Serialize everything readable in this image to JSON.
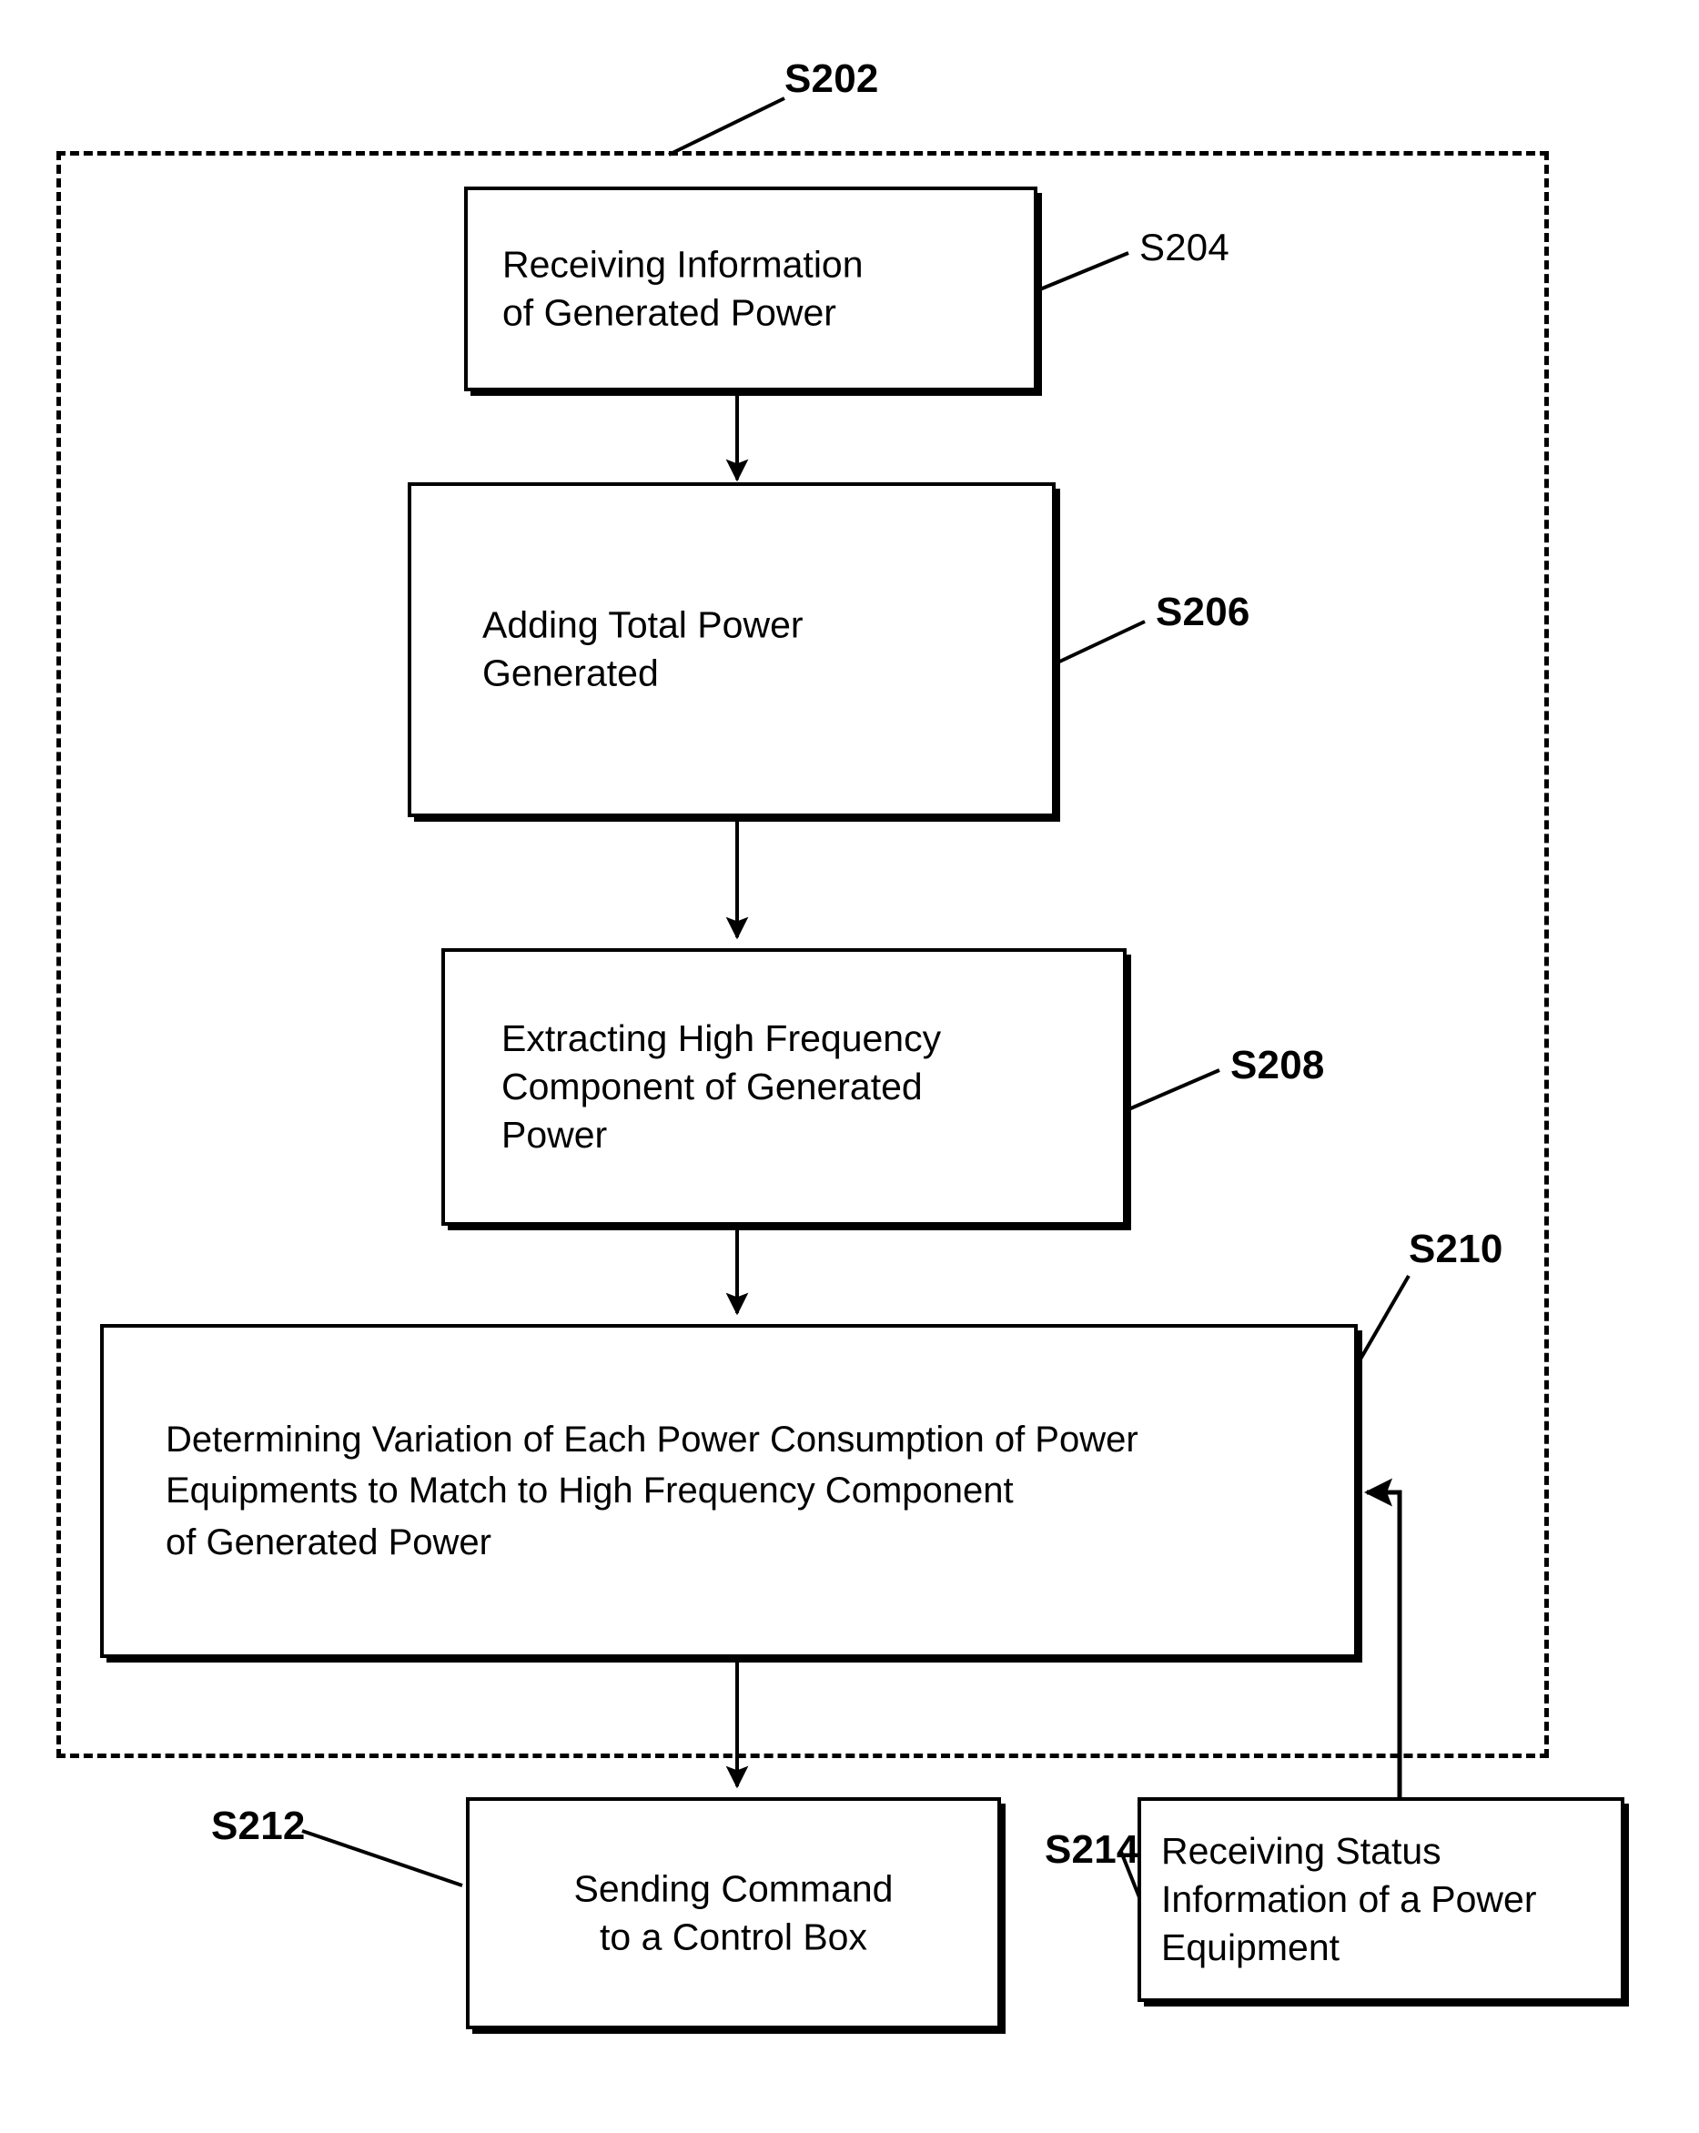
{
  "figure": {
    "type": "patent-process-flowchart",
    "title_label": "S202",
    "ink_color": "#000000",
    "background_color": "#ffffff"
  },
  "boundary": {
    "name": "dashed-process-boundary",
    "ref": "S202",
    "style": "dashed"
  },
  "steps": [
    {
      "ref": "S204",
      "ref_weight": "regular",
      "text": "Receiving Information\nof Generated Power",
      "align": "left"
    },
    {
      "ref": "S206",
      "ref_weight": "bold",
      "text": "Adding Total Power\nGenerated",
      "align": "left"
    },
    {
      "ref": "S208",
      "ref_weight": "bold",
      "text": "Extracting High Frequency\nComponent of Generated\nPower",
      "align": "left"
    },
    {
      "ref": "S210",
      "ref_weight": "bold",
      "text": "Determining Variation of Each Power Consumption of Power\nEquipments to Match to High Frequency Component\nof Generated Power",
      "align": "left"
    },
    {
      "ref": "S212",
      "ref_weight": "bold",
      "text": "Sending Command\nto a Control Box",
      "align": "center"
    },
    {
      "ref": "S214",
      "ref_weight": "bold",
      "text": "Receiving Status\nInformation of a Power\nEquipment",
      "align": "left"
    }
  ],
  "connectors": [
    {
      "name": "arrow-s204-to-s206",
      "kind": "straight-down-arrow"
    },
    {
      "name": "arrow-s206-to-s208",
      "kind": "straight-down-arrow"
    },
    {
      "name": "arrow-s208-to-s210",
      "kind": "straight-down-arrow"
    },
    {
      "name": "arrow-s210-to-s212",
      "kind": "straight-down-arrow"
    },
    {
      "name": "arrow-s214-feedback-to-s210",
      "kind": "elbow-left-arrow"
    }
  ],
  "leaders": [
    {
      "name": "leader-s202",
      "ref": "S202"
    },
    {
      "name": "leader-s204",
      "ref": "S204"
    },
    {
      "name": "leader-s206",
      "ref": "S206"
    },
    {
      "name": "leader-s208",
      "ref": "S208"
    },
    {
      "name": "leader-s210",
      "ref": "S210"
    },
    {
      "name": "leader-s212",
      "ref": "S212"
    },
    {
      "name": "leader-s214",
      "ref": "S214"
    }
  ]
}
